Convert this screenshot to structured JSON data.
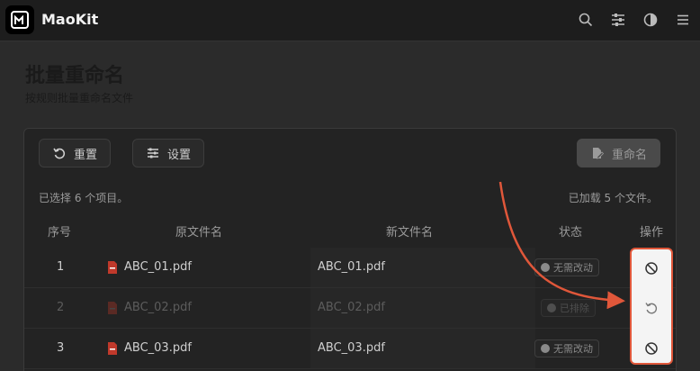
{
  "app": {
    "name": "MaoKit"
  },
  "header_icons": [
    "search-icon",
    "sliders-icon",
    "contrast-icon",
    "menu-icon"
  ],
  "page": {
    "title": "批量重命名",
    "subtitle": "按规则批量重命名文件"
  },
  "toolbar": {
    "reset_label": "重置",
    "settings_label": "设置",
    "rename_label": "重命名"
  },
  "status": {
    "selected": "已选择 6 个项目。",
    "loaded": "已加载 5 个文件。"
  },
  "table": {
    "headers": {
      "index": "序号",
      "original": "原文件名",
      "new": "新文件名",
      "state": "状态",
      "action": "操作"
    },
    "rows": [
      {
        "index": "1",
        "original": "ABC_01.pdf",
        "new": "ABC_01.pdf",
        "state": "无需改动",
        "dim": false,
        "action_icon": "ban-icon"
      },
      {
        "index": "2",
        "original": "ABC_02.pdf",
        "new": "ABC_02.pdf",
        "state": "已排除",
        "dim": true,
        "action_icon": "undo-icon"
      },
      {
        "index": "3",
        "original": "ABC_03.pdf",
        "new": "ABC_03.pdf",
        "state": "无需改动",
        "dim": false,
        "action_icon": "ban-icon"
      }
    ]
  },
  "colors": {
    "highlight": "#e0573a",
    "pdf": "#c0392b"
  }
}
